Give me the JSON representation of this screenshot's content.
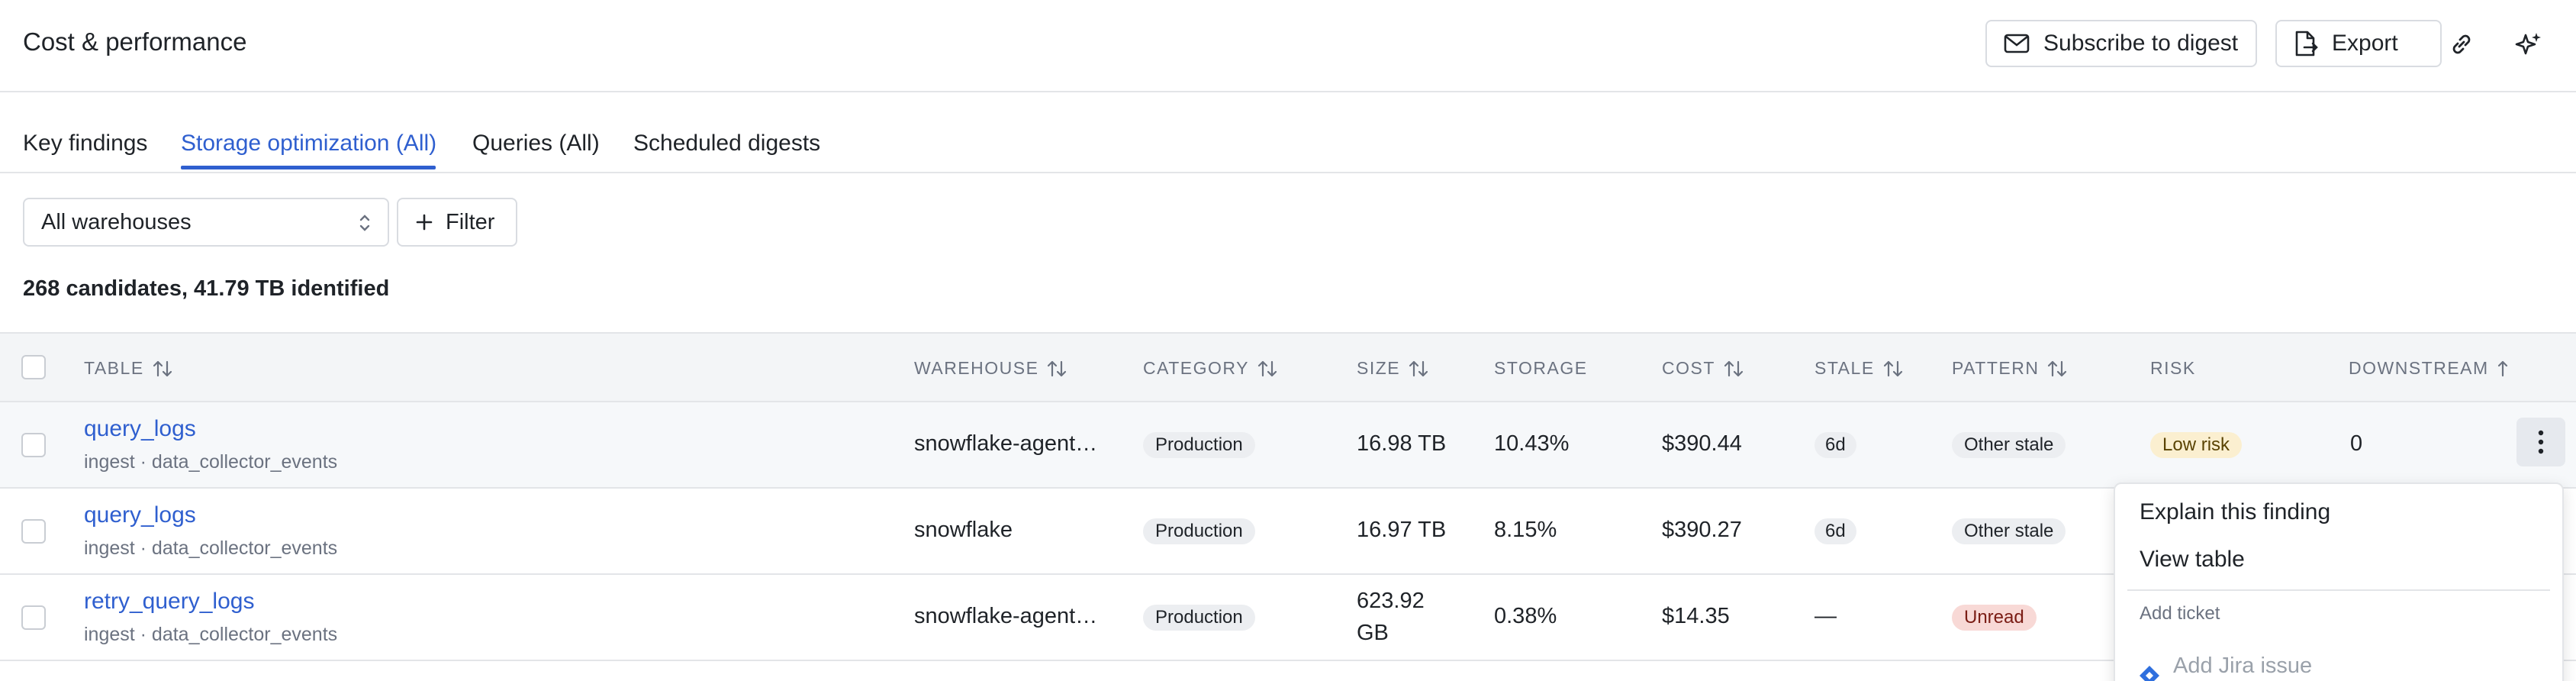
{
  "header": {
    "title": "Cost & performance",
    "subscribe_label": "Subscribe to digest",
    "export_label": "Export"
  },
  "tabs": [
    {
      "label": "Key findings",
      "active": false
    },
    {
      "label": "Storage optimization (All)",
      "active": true
    },
    {
      "label": "Queries (All)",
      "active": false
    },
    {
      "label": "Scheduled digests",
      "active": false
    }
  ],
  "toolbar": {
    "warehouse_select": "All warehouses",
    "filter_label": "Filter"
  },
  "summary": "268 candidates, 41.79 TB identified",
  "table": {
    "columns": [
      "TABLE",
      "WAREHOUSE",
      "CATEGORY",
      "SIZE",
      "STORAGE",
      "COST",
      "STALE",
      "PATTERN",
      "RISK",
      "DOWNSTREAM"
    ],
    "rows": [
      {
        "name": "query_logs",
        "sub": "ingest · data_collector_events",
        "warehouse": "snowflake-agent…",
        "category": "Production",
        "size": "16.98 TB",
        "storage": "10.43%",
        "cost": "$390.44",
        "stale": "6d",
        "pattern": "Other stale",
        "risk": "Low risk",
        "downstream": "0"
      },
      {
        "name": "query_logs",
        "sub": "ingest · data_collector_events",
        "warehouse": "snowflake",
        "category": "Production",
        "size": "16.97 TB",
        "storage": "8.15%",
        "cost": "$390.27",
        "stale": "6d",
        "pattern": "Other stale",
        "risk": "",
        "downstream": ""
      },
      {
        "name": "retry_query_logs",
        "sub": "ingest · data_collector_events",
        "warehouse": "snowflake-agent…",
        "category": "Production",
        "size_line1": "623.92",
        "size_line2": "GB",
        "storage": "0.38%",
        "cost": "$14.35",
        "stale": "—",
        "pattern": "Unread",
        "risk": "",
        "downstream": ""
      }
    ]
  },
  "context_menu": {
    "items": [
      "Explain this finding",
      "View table"
    ],
    "section_header": "Add ticket",
    "jira_label": "Add Jira issue"
  },
  "colors": {
    "accent": "#2f5fcf",
    "low_risk_bg": "#fbefd0",
    "unread_bg": "#f8d9d6",
    "pill_bg": "#eceef1"
  }
}
